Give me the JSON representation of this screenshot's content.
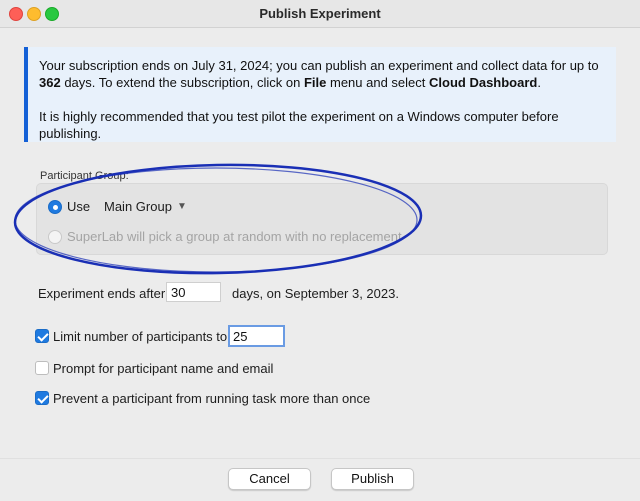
{
  "window": {
    "title": "Publish Experiment"
  },
  "notice": {
    "line1_before": "Your subscription ends on July 31, 2024; you can publish an experiment and collect data for up to ",
    "days_bold": "362",
    "line1_mid": " days. To extend the subscription, click on ",
    "file_bold": "File",
    "line1_mid2": " menu and select ",
    "dashboard_bold": "Cloud Dashboard",
    "line1_end": ".",
    "line2": "It is highly recommended that you test pilot the experiment on a Windows computer before publishing."
  },
  "participant_group": {
    "label": "Participant Group:",
    "use_label": "Use",
    "selected_group": "Main Group",
    "random_label": "SuperLab will pick a group at random with no replacement",
    "use_selected": true
  },
  "experiment_end": {
    "label": "Experiment ends after",
    "days_value": "30",
    "suffix": "days, on September 3, 2023."
  },
  "options": {
    "limit_label": "Limit number of participants to",
    "limit_checked": true,
    "limit_value": "25",
    "prompt_label": "Prompt for participant name and email",
    "prompt_checked": false,
    "prevent_label": "Prevent a participant from running task more than once",
    "prevent_checked": true
  },
  "buttons": {
    "cancel": "Cancel",
    "publish": "Publish"
  },
  "colors": {
    "accent": "#1f7ae0",
    "notice_bar": "#1460d6",
    "annotation_oval": "#1a2fb5"
  }
}
